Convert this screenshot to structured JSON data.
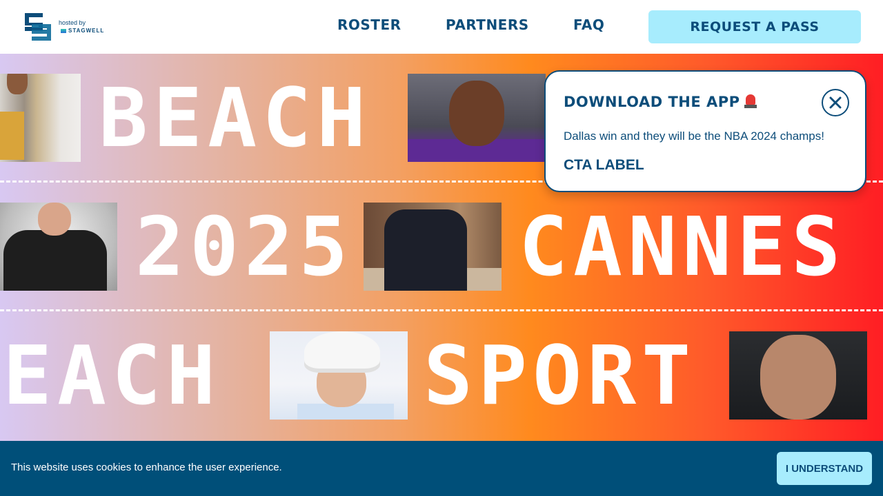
{
  "header": {
    "logo_icon": "sb-logo-icon",
    "hosted_by": "hosted by",
    "host_brand": "STAGWELL",
    "nav": [
      {
        "label": "ROSTER"
      },
      {
        "label": "PARTNERS"
      },
      {
        "label": "FAQ"
      }
    ],
    "cta_label": "REQUEST A PASS"
  },
  "hero": {
    "words": [
      "BEACH",
      "2025",
      "CANNES",
      "EACH",
      "SPORT"
    ],
    "gradient_colors": [
      "#d8c8f2",
      "#ff8a1e",
      "#ff1e24"
    ]
  },
  "popup": {
    "title": "DOWNLOAD THE APP",
    "title_icon": "siren-icon",
    "body": "Dallas win and they will be the NBA 2024 champs!",
    "cta_label": "CTA LABEL",
    "close_icon": "close-icon"
  },
  "cookie": {
    "text": "This website uses cookies to enhance the user experience.",
    "button_label": "I UNDERSTAND"
  },
  "colors": {
    "brand_navy": "#0d4d7a",
    "accent_cyan": "#a7ecfd",
    "cookie_bg": "#004f79"
  }
}
